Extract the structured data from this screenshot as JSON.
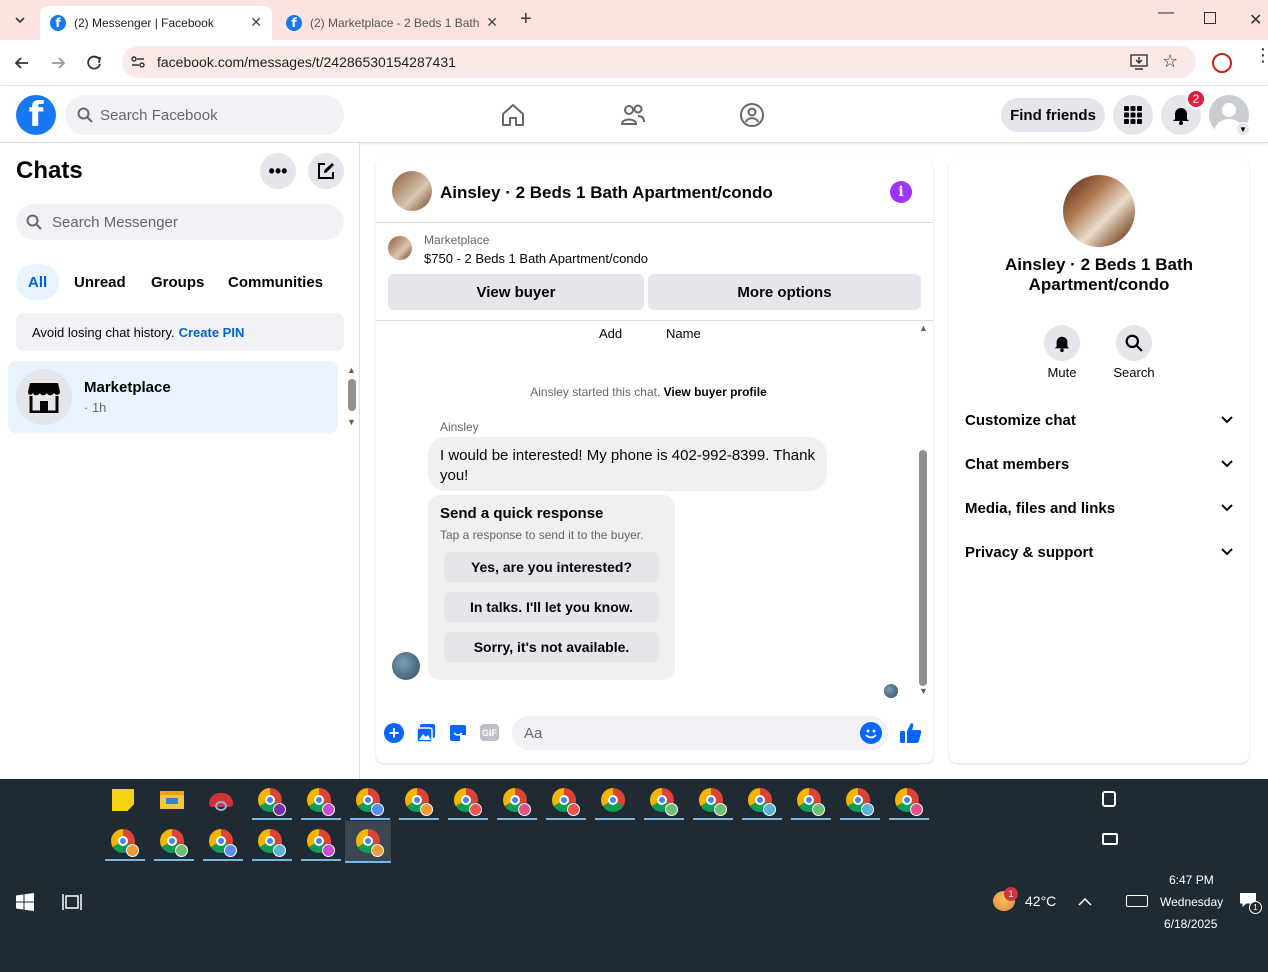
{
  "browser": {
    "tabs": [
      {
        "title": "(2) Messenger | Facebook"
      },
      {
        "title": "(2) Marketplace - 2 Beds 1 Bath"
      }
    ],
    "url": "facebook.com/messages/t/24286530154287431"
  },
  "header": {
    "search_placeholder": "Search Facebook",
    "find_friends": "Find friends",
    "notif_count": "2"
  },
  "sidebar": {
    "title": "Chats",
    "search_placeholder": "Search Messenger",
    "filters": [
      "All",
      "Unread",
      "Groups",
      "Communities"
    ],
    "pin_text": "Avoid losing chat history.",
    "pin_link": "Create PIN",
    "chat": {
      "name": "Marketplace",
      "time": "· 1h"
    }
  },
  "conversation": {
    "title": "Ainsley · 2 Beds 1 Bath Apartment/condo",
    "marketplace_label": "Marketplace",
    "listing": "$750 - 2 Beds 1 Bath Apartment/condo",
    "view_buyer": "View buyer",
    "more_options": "More options",
    "col_add": "Add",
    "col_name": "Name",
    "started_text": "Ainsley started this chat.",
    "view_profile": "View buyer profile",
    "sender": "Ainsley",
    "message": "I would be interested! My phone is 402-992-8399. Thank you!",
    "qr_title": "Send a quick response",
    "qr_subtitle": "Tap a response to send it to the buyer.",
    "quick_responses": [
      "Yes, are you interested?",
      "In talks. I'll let you know.",
      "Sorry, it's not available."
    ],
    "composer_placeholder": "Aa",
    "gif": "GIF"
  },
  "right_panel": {
    "title": "Ainsley · 2 Beds 1 Bath Apartment/condo",
    "mute": "Mute",
    "search": "Search",
    "sections": [
      "Customize chat",
      "Chat members",
      "Media, files and links",
      "Privacy & support"
    ]
  },
  "taskbar": {
    "weather_temp": "42°C",
    "weather_badge": "1",
    "time": "6:47 PM",
    "day": "Wednesday",
    "date": "6/18/2025",
    "action_badge": "1"
  }
}
